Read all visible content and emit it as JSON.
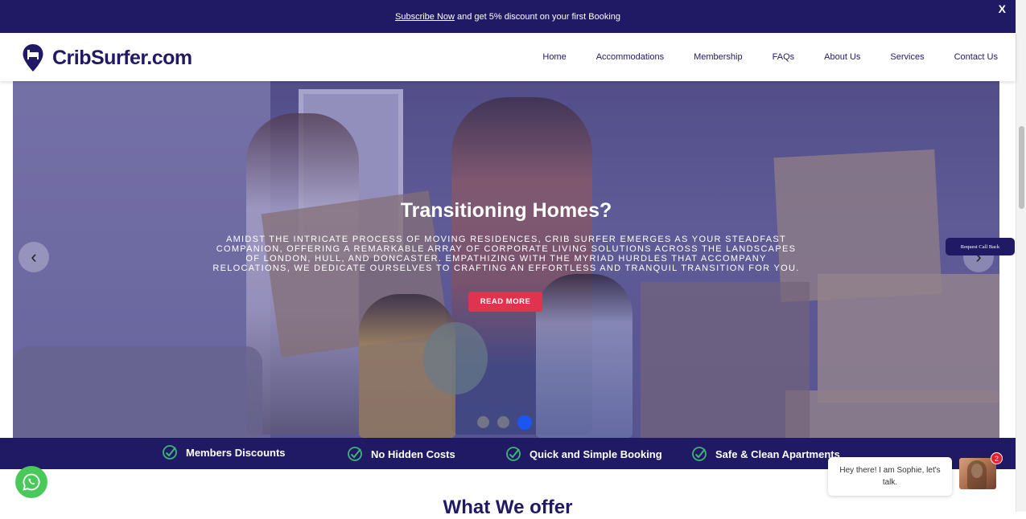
{
  "promo": {
    "link": "Subscribe Now",
    "text": "and get 5% discount on your first Booking",
    "close": "X"
  },
  "header": {
    "logo_text": "CribSurfer.com",
    "nav": [
      "Home",
      "Accommodations",
      "Membership",
      "FAQs",
      "About Us",
      "Services",
      "Contact Us"
    ]
  },
  "hero": {
    "title": "Transitioning Homes?",
    "text": "AMIDST THE INTRICATE PROCESS OF MOVING RESIDENCES, CRIB SURFER EMERGES AS YOUR STEADFAST COMPANION, OFFERING A REMARKABLE ARRAY OF CORPORATE LIVING SOLUTIONS ACROSS THE LANDSCAPES OF LONDON, HULL, AND DONCASTER. EMPATHIZING WITH THE MYRIAD HURDLES THAT ACCOMPANY RELOCATIONS, WE DEDICATE OURSELVES TO CRAFTING AN EFFORTLESS AND TRANQUIL TRANSITION FOR YOU.",
    "button": "READ MORE",
    "prev_icon": "‹",
    "next_icon": "›",
    "slide_count": 3,
    "active_slide": 3
  },
  "callback": "Request Call Back",
  "features": [
    "Members Discounts",
    "No Hidden Costs",
    "Quick and Simple Booking",
    "Safe & Clean Apartments"
  ],
  "section_title": "What We offer",
  "chat": {
    "message": "Hey there! I am Sophie, let's talk.",
    "badge": "2"
  },
  "colors": {
    "brand": "#1f1a63",
    "accent": "#e0334f",
    "active_dot": "#1a56f0",
    "whatsapp": "#4ac95b",
    "check": "#3fb47a"
  }
}
